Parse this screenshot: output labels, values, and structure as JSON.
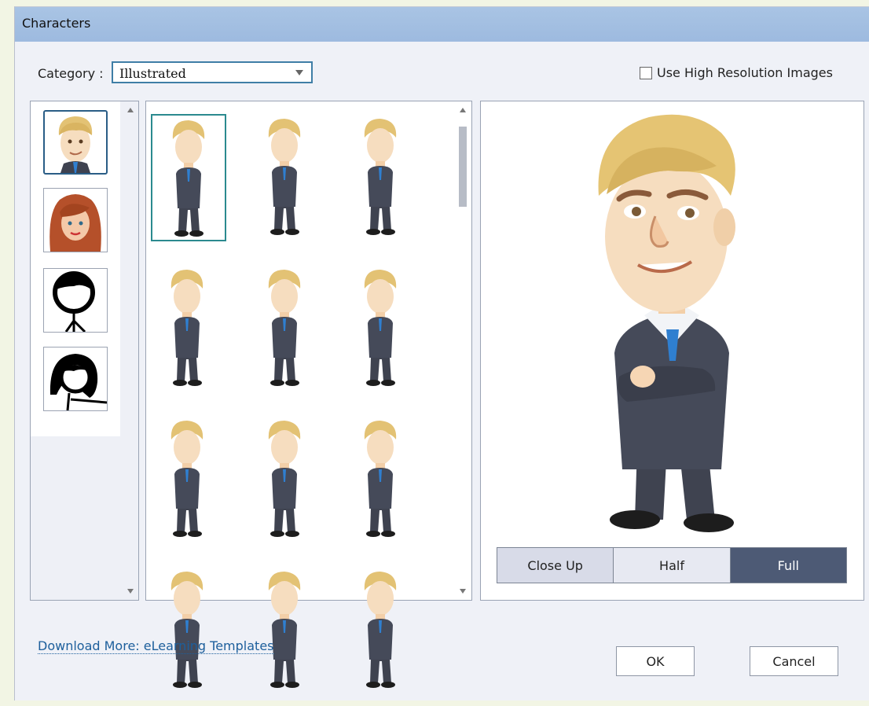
{
  "window": {
    "title": "Characters"
  },
  "category": {
    "label": "Category :",
    "value": "Illustrated"
  },
  "hires": {
    "label": "Use High Resolution Images",
    "checked": false
  },
  "view_modes": [
    "Close Up",
    "Half",
    "Full"
  ],
  "selected_view": "Full",
  "download_link": "Download More: eLearning Templates",
  "buttons": {
    "ok": "OK",
    "cancel": "Cancel"
  },
  "characters": [
    {
      "name": "businessman-illustrated",
      "selected": true
    },
    {
      "name": "redhead-woman-illustrated",
      "selected": false
    },
    {
      "name": "stick-figure-man",
      "selected": false
    },
    {
      "name": "stick-figure-woman",
      "selected": false
    }
  ],
  "poses": {
    "visible_rows": 4,
    "columns": 3,
    "selected_index": 0
  },
  "colors": {
    "accent": "#2b8a8f",
    "title_bar": "#a9c4e4",
    "active_view": "#4d5a75"
  }
}
